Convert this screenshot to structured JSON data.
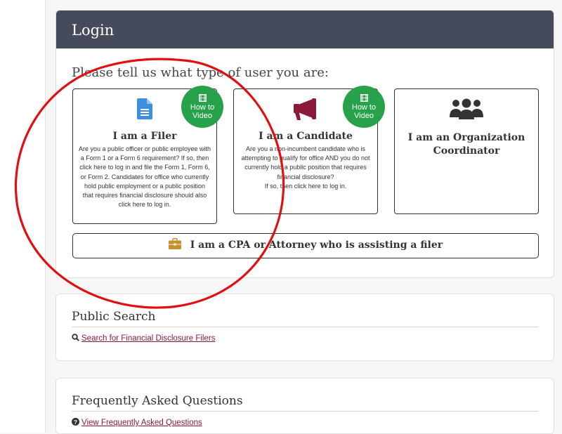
{
  "login": {
    "title": "Login",
    "prompt": "Please tell us what type of user you are:",
    "roles": [
      {
        "title": "I am a Filer",
        "description": "Are you a public officer or public employee with a Form 1 or a Form 6 requirement? If so, then click here to log in and file the Form 1, Form 6, or Form 2. Candidates for office who currently hold public employment or a public position that requires financial disclosure should also click here to log in.",
        "icon": "document-icon",
        "video_badge": "How to Video"
      },
      {
        "title": "I am a Candidate",
        "description_lines": [
          "Are you a non-incumbent candidate who is attempting to qualify for office AND you do not currently hold a public position that requires financial disclosure?",
          "If so, then click here to log in."
        ],
        "icon": "megaphone-icon",
        "video_badge": "How to Video"
      },
      {
        "title": "I am an Organization Coordinator",
        "icon": "users-icon"
      }
    ],
    "cpa_button": "I am a CPA or Attorney who is assisting a filer"
  },
  "public_search": {
    "title": "Public Search",
    "link": "Search for Financial Disclosure Filers",
    "icon": "search-icon"
  },
  "faq": {
    "title": "Frequently Asked Questions",
    "link": "View Frequently Asked Questions",
    "icon": "question-circle-icon"
  },
  "colors": {
    "header_bg": "#464b5b",
    "badge_green": "#27a24a",
    "filer_icon_blue": "#3d8fe0",
    "candidate_icon_maroon": "#8a1a3a",
    "link_color": "#8a1a3a",
    "briefcase_gold": "#c8902a",
    "annotation_red": "#e01010"
  }
}
